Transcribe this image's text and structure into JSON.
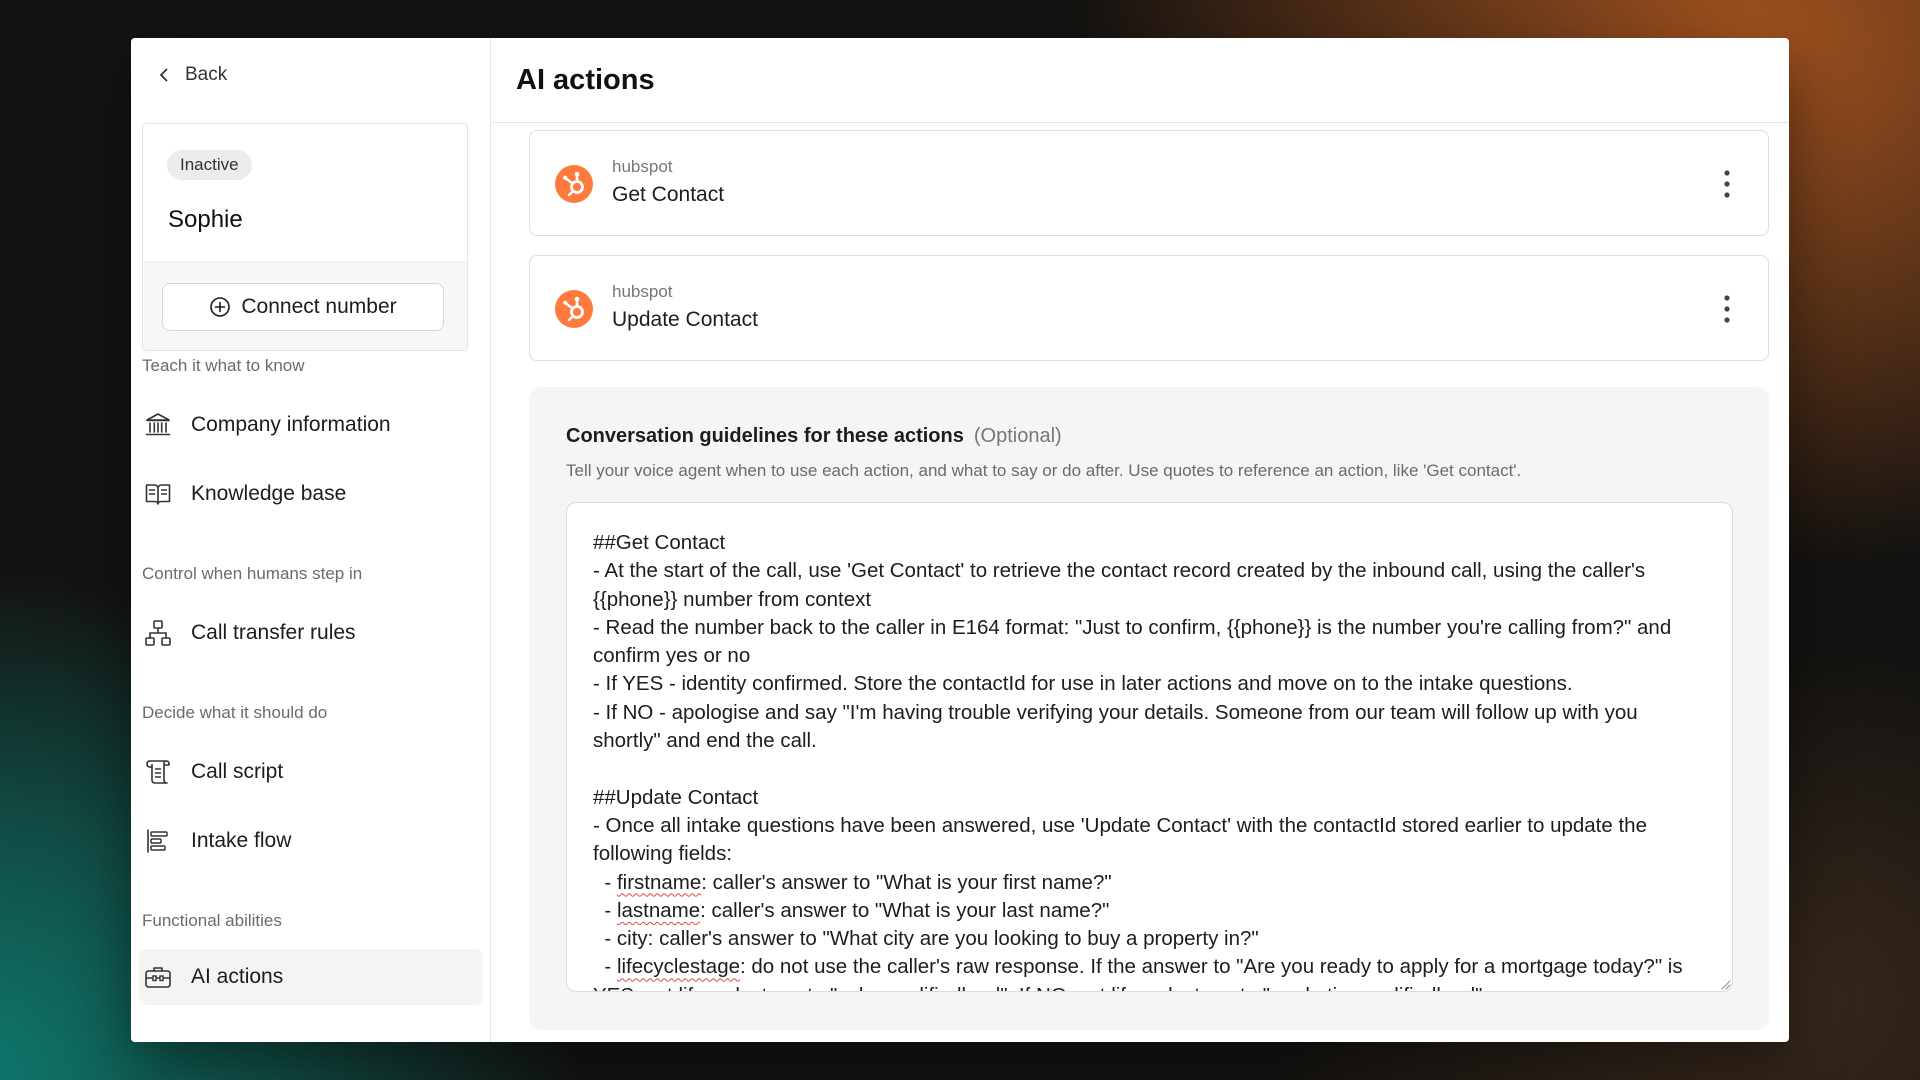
{
  "sidebar": {
    "back_label": "Back",
    "agent": {
      "status": "Inactive",
      "name": "Sophie",
      "connect_label": "Connect number"
    },
    "sections": [
      {
        "label": "Teach it what to know",
        "items": [
          {
            "label": "Company information",
            "icon": "bank-icon"
          },
          {
            "label": "Knowledge base",
            "icon": "book-icon"
          }
        ]
      },
      {
        "label": "Control when humans step in",
        "items": [
          {
            "label": "Call transfer rules",
            "icon": "hierarchy-icon"
          }
        ]
      },
      {
        "label": "Decide what it should do",
        "items": [
          {
            "label": "Call script",
            "icon": "scroll-icon"
          },
          {
            "label": "Intake flow",
            "icon": "align-left-icon"
          }
        ]
      },
      {
        "label": "Functional abilities",
        "items": [
          {
            "label": "AI actions",
            "icon": "toolbox-icon",
            "active": true
          }
        ]
      }
    ]
  },
  "main": {
    "title": "AI actions",
    "actions": [
      {
        "provider": "hubspot",
        "name": "Get Contact"
      },
      {
        "provider": "hubspot",
        "name": "Update Contact"
      }
    ],
    "guidelines": {
      "title": "Conversation guidelines for these actions",
      "optional_label": "(Optional)",
      "description": "Tell your voice agent when to use each action, and what to say or do after. Use quotes to reference an action, like 'Get contact'.",
      "text": "##Get Contact\n- At the start of the call, use 'Get Contact' to retrieve the contact record created by the inbound call, using the caller's {{phone}} number from context\n- Read the number back to the caller in E164 format: \"Just to confirm, {{phone}} is the number you're calling from?\" and confirm yes or no\n- If YES - identity confirmed. Store the contactId for use in later actions and move on to the intake questions.\n- If NO - apologise and say \"I'm having trouble verifying your details. Someone from our team will follow up with you shortly\" and end the call.\n\n##Update Contact\n- Once all intake questions have been answered, use 'Update Contact' with the contactId stored earlier to update the following fields:\n  - firstname: caller's answer to \"What is your first name?\"\n  - lastname: caller's answer to \"What is your last name?\"\n  - city: caller's answer to \"What city are you looking to buy a property in?\"\n  - lifecyclestage: do not use the caller's raw response. If the answer to \"Are you ready to apply for a mortgage today?\" is YES, set lifecyclestage to \"salesqualifiedlead\". If NO, set lifecyclestage to \"marketingqualifiedlead\"."
    }
  },
  "colors": {
    "hubspot_orange": "#ff7a3d",
    "accent_text": "#1d1d1f"
  }
}
